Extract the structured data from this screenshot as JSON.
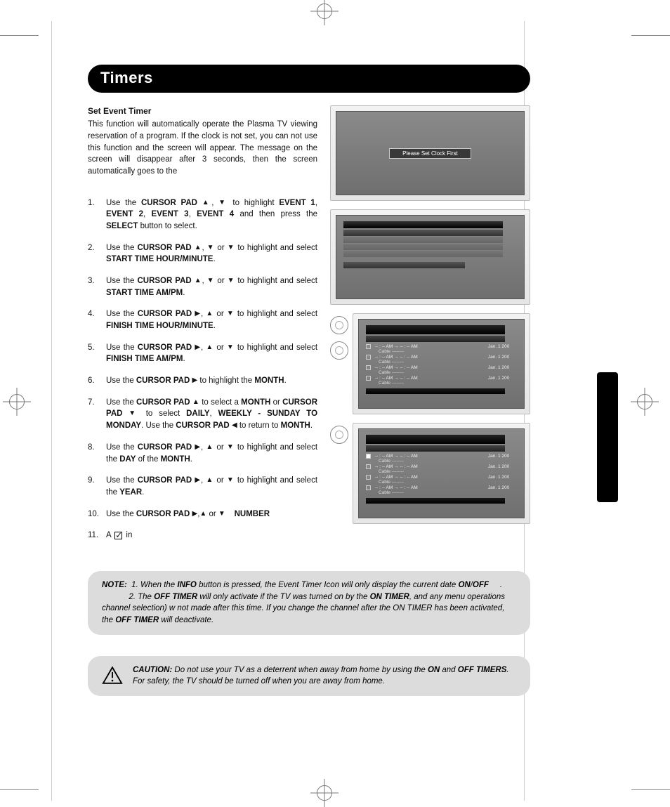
{
  "title": "Timers",
  "subhead": "Set Event Timer",
  "intro": "This function will automatically operate the Plasma TV viewing reservation of a program. If the clock is not set, you can not use this function and the screen          will appear. The message on the screen will disappear after 3 seconds, then the screen automatically goes to the",
  "steps": {
    "s1a": "Use the ",
    "s1b": "CURSOR PAD ",
    "s1c": " to highlight ",
    "s1d": "EVENT 1",
    "s1e": "EVENT 2",
    "s1f": "EVENT 3",
    "s1g": "EVENT 4",
    "s1h": " and then press the ",
    "s1i": "SELECT",
    "s1j": " button to select.",
    "s2a": "Use the ",
    "s2b": "CURSOR PAD ",
    "s2c": " or ",
    "s2d": " to highlight and select ",
    "s2e": "START TIME HOUR/MINUTE",
    "s3e": "START TIME AM/PM",
    "s4e": "FINISH TIME HOUR/MINUTE",
    "s5e": "FINISH TIME AM/PM",
    "s6a": "Use the ",
    "s6b": "CURSOR PAD ",
    "s6c": " to highlight the ",
    "s6d": "MONTH",
    "s7a": "Use the ",
    "s7b": "CURSOR PAD ",
    "s7c": " to select a ",
    "s7d": "MONTH",
    "s7e": " or ",
    "s7f": "CURSOR PAD ",
    "s7g": " to select ",
    "s7h": "DAILY",
    "s7i": "WEEKLY - SUNDAY TO MONDAY",
    "s7j": ". Use the ",
    "s7k": "CURSOR PAD ",
    "s7l": " to return to ",
    "s7m": "MONTH",
    "s8a": "Use the ",
    "s8c": " or ",
    "s8d": " to highlight and select the ",
    "s8e": "DAY",
    "s8f": " of the ",
    "s8g": "MONTH",
    "s9d": " to highlight and select the ",
    "s9e": "YEAR",
    "s10a": "Use the ",
    "s10b": "CURSOR PAD ",
    "s10c": " or ",
    "s10d": "NUMBER",
    "s11a": "A ",
    "s11b": " in"
  },
  "fig1_msg": "Please Set Clock First",
  "event_line_time": "-- : -- AM  →  -- : -- AM",
  "event_line_date": "Jan. 1 200",
  "event_line_sub": "Cable     --------",
  "note": {
    "label": "NOTE:",
    "l1a": "1.  When the ",
    "l1b": "INFO",
    "l1c": " button is pressed, the Event Timer Icon will only display the current date ",
    "l1d": "ON",
    "l1e": "OFF",
    "l2a": "2. The ",
    "l2b": "OFF TIMER",
    "l2c": " will only activate if the TV was turned on by the ",
    "l2d": "ON TIMER",
    "l2e": ", and any menu operations             channel selection) w      not made after this time. If you change the channel after the ON TIMER has been activated, the ",
    "l2f": "OFF TIMER",
    "l2g": " will deactivate."
  },
  "caution": {
    "label": "CAUTION:",
    "t1": " Do not use your TV as a deterrent when away from home by using the ",
    "t2": "ON",
    "t3": " and ",
    "t4": "OFF TIMERS",
    "t5": ". For safety, the TV should be turned off when you are away from home."
  }
}
